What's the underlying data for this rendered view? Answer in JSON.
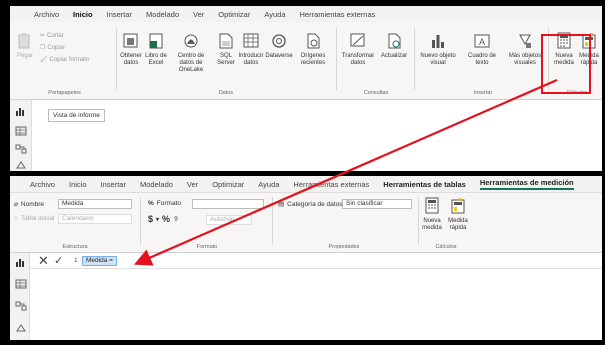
{
  "top": {
    "menu": [
      "Archivo",
      "Inicio",
      "Insertar",
      "Modelado",
      "Ver",
      "Optimizar",
      "Ayuda",
      "Herramientas externas"
    ],
    "active_menu": "Inicio",
    "clipboard": {
      "paste": "Pegar",
      "cut": "Cortar",
      "copy": "Copiar",
      "copy_format": "Copiar formato",
      "group": "Portapapeles"
    },
    "data": {
      "get_data": "Obtener datos",
      "excel": "Libro de Excel",
      "onelake": "Centro de datos de OneLake",
      "sql": "SQL Server",
      "enter": "Introducir datos",
      "dataverse": "Dataverse",
      "recent": "Orígenes recientes",
      "group": "Datos"
    },
    "queries": {
      "transform": "Transformar datos",
      "refresh": "Actualizar",
      "group": "Consultas"
    },
    "insert": {
      "new_visual": "Nuevo objeto visual",
      "textbox": "Cuadro de texto",
      "more_visuals": "Más objetos visuales",
      "group": "Insertar"
    },
    "calc": {
      "new_measure": "Nueva medida",
      "quick_measure": "Medida rápida",
      "group": "Cálculos"
    },
    "tooltip": "Vista de informe"
  },
  "bottom": {
    "menu": [
      "Archivo",
      "Inicio",
      "Insertar",
      "Modelado",
      "Ver",
      "Optimizar",
      "Ayuda",
      "Herramientas externas",
      "Herramientas de tablas",
      "Herramientas de medición"
    ],
    "structure": {
      "name_label": "Nombre",
      "name_value": "Medida",
      "home_table_label": "Tabla inicial",
      "home_table_value": "Calendario",
      "group": "Estructura"
    },
    "format": {
      "format_label": "Formato",
      "currency": "$",
      "percent": "%",
      "comma": "9",
      "decimals": "Automát",
      "group": "Formato"
    },
    "properties": {
      "category_label": "Categoría de datos",
      "category_value": "Sin clasificar",
      "group": "Propiedades"
    },
    "calc": {
      "new_measure": "Nueva medida",
      "quick_measure": "Medida rápida",
      "group": "Cálculos"
    },
    "formula": {
      "line": "1",
      "text": "Medida ="
    }
  },
  "colors": {
    "highlight": "#e3121e",
    "accent": "#117865",
    "chart_yellow": "#f2c811"
  }
}
